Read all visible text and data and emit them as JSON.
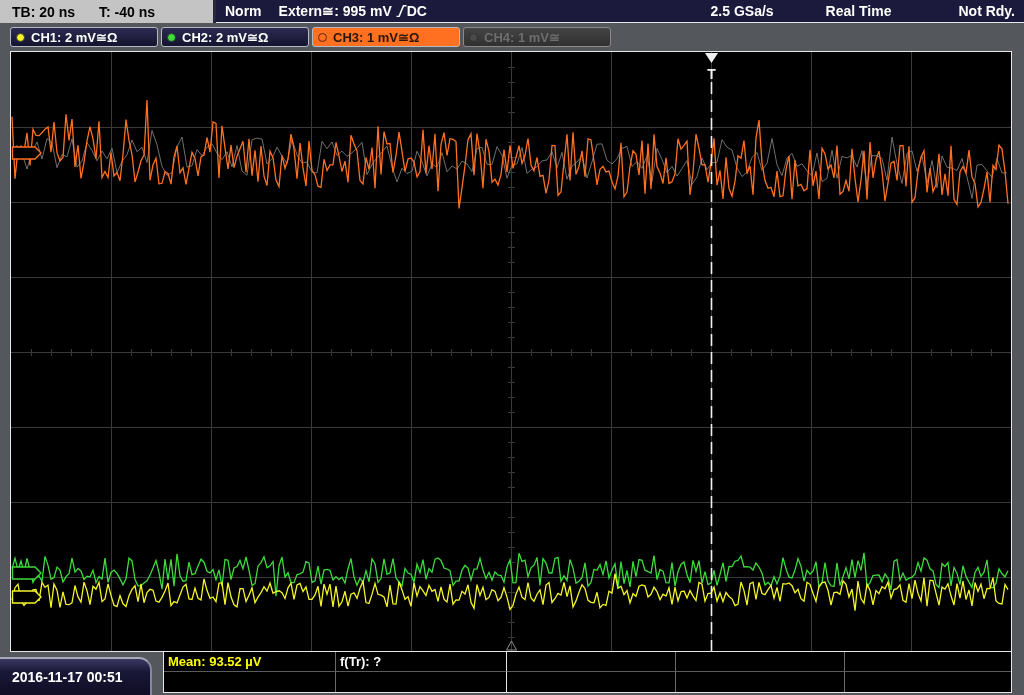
{
  "top_bar": {
    "timebase": "TB: 20 ns",
    "trigger_offset": "T: -40 ns",
    "trigger_mode": "Norm",
    "trigger_source": "Extern≅: 995 mV",
    "trigger_coupling": "DC",
    "sample_rate": "2.5 GSa/s",
    "acquisition_mode": "Real Time",
    "status": "Not Rdy."
  },
  "channels": [
    {
      "label": "CH1: 2 mV≅Ω",
      "color": "#f5f528",
      "selected": false,
      "disabled": false
    },
    {
      "label": "CH2: 2 mV≅Ω",
      "color": "#3cdc3c",
      "selected": false,
      "disabled": false
    },
    {
      "label": "CH3: 1 mV≅Ω",
      "color": "#ff7020",
      "selected": true,
      "disabled": false
    },
    {
      "label": "CH4: 1 mV≅",
      "color": "#4a4a4a",
      "selected": false,
      "disabled": true
    }
  ],
  "screen": {
    "trigger_marker": "T"
  },
  "date_time": "2016-11-17 00:51",
  "measurements": [
    {
      "text": "Mean: 93.52 µV",
      "color": "#ffff00"
    },
    {
      "text": "f(Tr): ?",
      "color": "#ffffff"
    }
  ]
}
